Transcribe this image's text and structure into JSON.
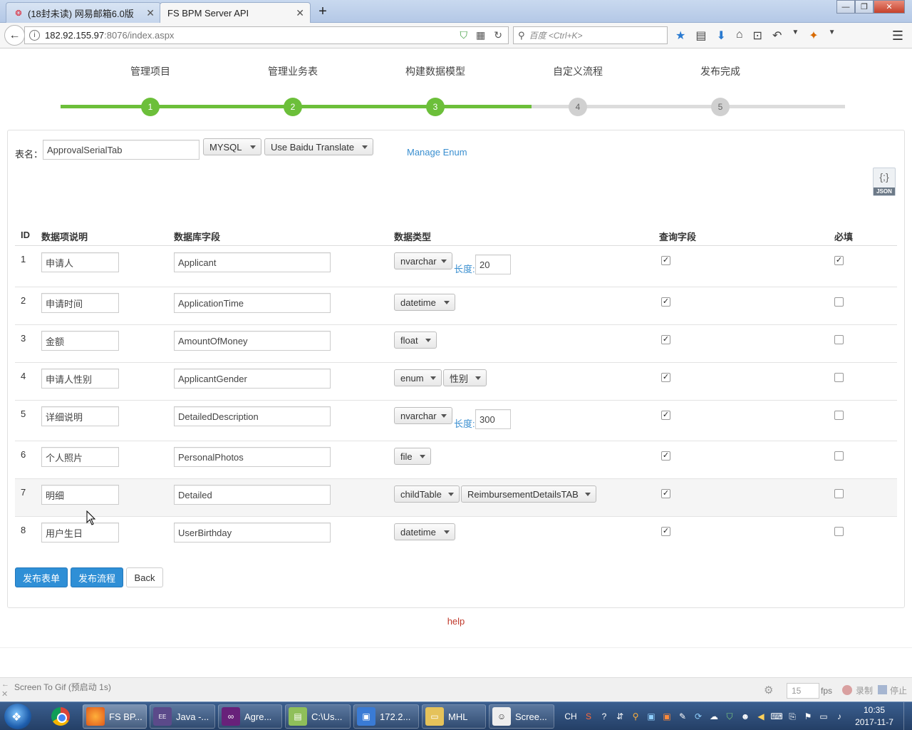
{
  "browser": {
    "tabs": [
      {
        "title": "(18封未读) 网易邮箱6.0版",
        "active": false
      },
      {
        "title": "FS BPM Server API",
        "active": true
      }
    ],
    "url_host": "182.92.155.97",
    "url_rest": ":8076/index.aspx",
    "search_placeholder": "百度 <Ctrl+K>"
  },
  "steps": [
    {
      "label": "管理项目",
      "num": "1",
      "done": true
    },
    {
      "label": "管理业务表",
      "num": "2",
      "done": true
    },
    {
      "label": "构建数据模型",
      "num": "3",
      "done": true
    },
    {
      "label": "自定义流程",
      "num": "4",
      "done": false
    },
    {
      "label": "发布完成",
      "num": "5",
      "done": false
    }
  ],
  "form": {
    "table_name_label": "表名：",
    "table_name_value": "ApprovalSerialTab",
    "db_select": "MYSQL",
    "translate_select": "Use Baidu Translate",
    "manage_enum": "Manage Enum",
    "json_label": "JSON",
    "json_braces": "{;}"
  },
  "grid": {
    "headers": {
      "id": "ID",
      "desc": "数据项说明",
      "field": "数据库字段",
      "type": "数据类型",
      "query": "查询字段",
      "required": "必填"
    },
    "length_label": "长度:",
    "rows": [
      {
        "id": "1",
        "desc": "申请人",
        "field": "Applicant",
        "type": "nvarchar",
        "extra": null,
        "length": "20",
        "query": true,
        "required": true
      },
      {
        "id": "2",
        "desc": "申请时间",
        "field": "ApplicationTime",
        "type": "datetime",
        "extra": null,
        "length": null,
        "query": true,
        "required": false
      },
      {
        "id": "3",
        "desc": "金额",
        "field": "AmountOfMoney",
        "type": "float",
        "extra": null,
        "length": null,
        "query": true,
        "required": false
      },
      {
        "id": "4",
        "desc": "申请人性别",
        "field": "ApplicantGender",
        "type": "enum",
        "extra": "性别",
        "length": null,
        "query": true,
        "required": false
      },
      {
        "id": "5",
        "desc": "详细说明",
        "field": "DetailedDescription",
        "type": "nvarchar",
        "extra": null,
        "length": "300",
        "query": true,
        "required": false
      },
      {
        "id": "6",
        "desc": "个人照片",
        "field": "PersonalPhotos",
        "type": "file",
        "extra": null,
        "length": null,
        "query": true,
        "required": false
      },
      {
        "id": "7",
        "desc": "明细",
        "field": "Detailed",
        "type": "childTable",
        "extra": "ReimbursementDetailsTAB",
        "length": null,
        "query": true,
        "required": false
      },
      {
        "id": "8",
        "desc": "用户生日",
        "field": "UserBirthday",
        "type": "datetime",
        "extra": null,
        "length": null,
        "query": true,
        "required": false
      }
    ]
  },
  "buttons": {
    "publish_form": "发布表单",
    "publish_flow": "发布流程",
    "back": "Back"
  },
  "help": "help",
  "statusbar": {
    "text": "Screen To Gif (预启动 1s)",
    "fps_value": "15",
    "fps_label": "fps",
    "record": "录制",
    "stop": "停止"
  },
  "taskbar": {
    "items": [
      "FS BP...",
      "Java -...",
      "Agre...",
      "C:\\Us...",
      "172.2...",
      "MHL",
      "Scree..."
    ],
    "tray_lang": "CH",
    "time": "10:35",
    "date": "2017-11-7"
  },
  "colors": {
    "accent": "#2f8fd6",
    "step_done": "#6cbf3a",
    "step_todo": "#d0d0d0",
    "link": "#3a8fd0",
    "help": "#c0392b"
  }
}
